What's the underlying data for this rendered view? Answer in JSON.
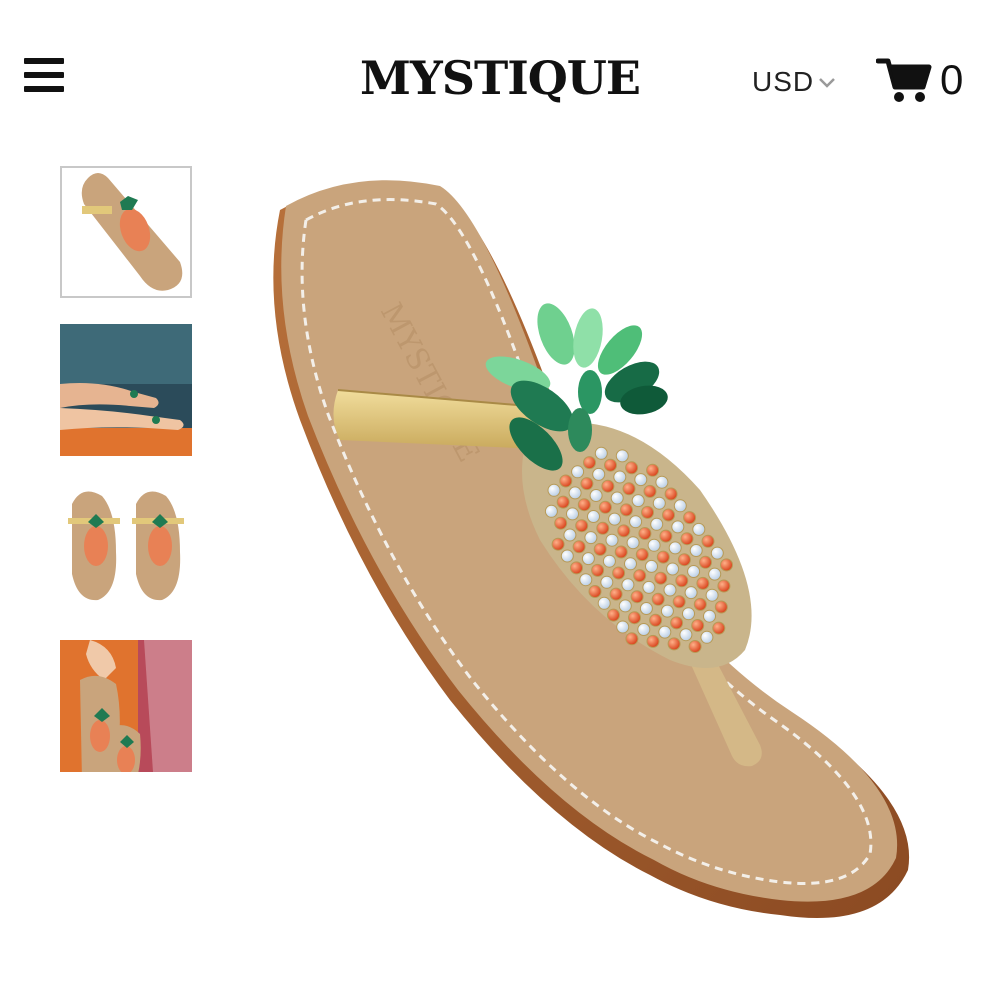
{
  "header": {
    "menu_icon": "hamburger-menu-icon",
    "logo_text": "MYSTIQUE",
    "currency": {
      "label": "USD",
      "icon": "chevron-down-icon"
    },
    "cart": {
      "icon": "shopping-cart-icon",
      "count": "0"
    }
  },
  "gallery": {
    "selected_index": 0,
    "thumbnails": [
      {
        "subject": "single-pineapple-sandal",
        "active": true
      },
      {
        "subject": "sandals-worn-on-feet",
        "active": false
      },
      {
        "subject": "pair-of-pineapple-sandals",
        "active": false
      },
      {
        "subject": "hand-holding-sandals",
        "active": false
      }
    ],
    "main_image": {
      "subject": "jeweled-pineapple-thong-sandal",
      "insole_stamp": "MYSTIQUE"
    }
  },
  "colors": {
    "insole": "#c9a47c",
    "stitch": "#f3efe9",
    "strap_gold": "#e2c87a",
    "gem_orange": "#e8582b",
    "gem_clear": "#eef3f8",
    "leaf_green": "#1f7a52",
    "leaf_light": "#6fd08f"
  }
}
